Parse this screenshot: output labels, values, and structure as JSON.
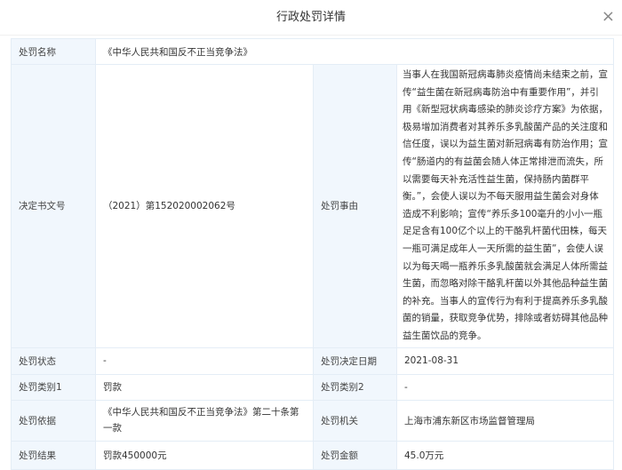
{
  "dialog": {
    "title": "行政处罚详情",
    "close_label": "×"
  },
  "fields": {
    "name": {
      "label": "处罚名称",
      "value": "《中华人民共和国反不正当竞争法》"
    },
    "doc_no": {
      "label": "决定书文号",
      "value": "（2021）第152020002062号"
    },
    "reason": {
      "label": "处罚事由",
      "value": "当事人在我国新冠病毒肺炎疫情尚未结束之前，宣传“益生菌在新冠病毒防治中有重要作用”，并引用《新型冠状病毒感染的肺炎诊疗方案》为依据，极易增加消费者对其养乐多乳酸菌产品的关注度和信任度，误以为益生菌对新冠病毒有防治作用；宣传“肠道内的有益菌会随人体正常排泄而流失，所以需要每天补充活性益生菌，保持肠内菌群平衡。”，会使人误以为不每天服用益生菌会对身体造成不利影响；宣传“养乐多100毫升的小小一瓶足足含有100亿个以上的干酪乳杆菌代田株，每天一瓶可满足成年人一天所需的益生菌”，会使人误以为每天喝一瓶养乐多乳酸菌就会满足人体所需益生菌，而忽略对除干酪乳杆菌以外其他品种益生菌的补充。当事人的宣传行为有利于提高养乐多乳酸菌的销量，获取竞争优势，排除或者妨碍其他品种益生菌饮品的竞争。"
    },
    "status": {
      "label": "处罚状态",
      "value": "-"
    },
    "date": {
      "label": "处罚决定日期",
      "value": "2021-08-31"
    },
    "type1": {
      "label": "处罚类别1",
      "value": "罚款"
    },
    "type2": {
      "label": "处罚类别2",
      "value": "-"
    },
    "basis": {
      "label": "处罚依据",
      "value": "《中华人民共和国反不正当竞争法》第二十条第一款"
    },
    "authority": {
      "label": "处罚机关",
      "value": "上海市浦东新区市场监督管理局"
    },
    "result": {
      "label": "处罚结果",
      "value": "罚款450000元"
    },
    "amount": {
      "label": "处罚金额",
      "value": "45.0万元"
    }
  }
}
